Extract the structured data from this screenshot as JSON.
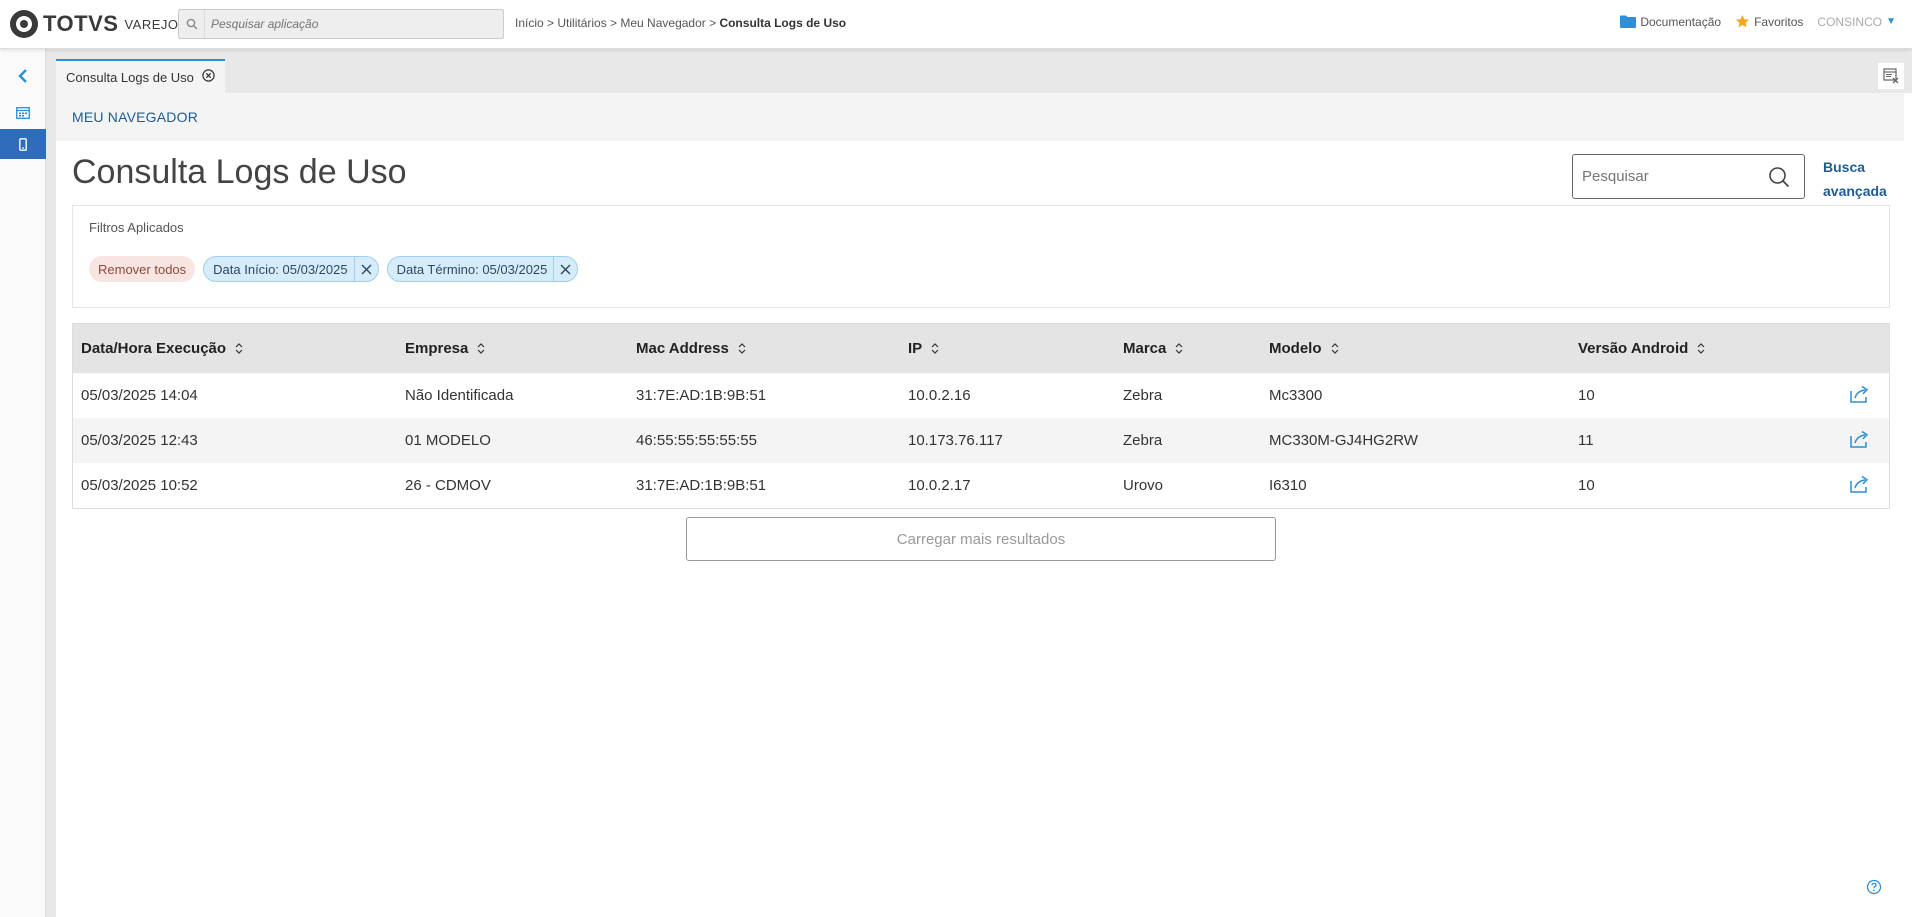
{
  "brand": {
    "name": "TOTVS",
    "sub": "VAREJO"
  },
  "app_search": {
    "placeholder": "Pesquisar aplicação"
  },
  "breadcrumb": {
    "path": "Início > Utilitários > Meu Navegador > ",
    "current": "Consulta Logs de Uso"
  },
  "top_links": {
    "docs": "Documentação",
    "favorites": "Favoritos",
    "user": "CONSINCO"
  },
  "tab": {
    "label": "Consulta Logs de Uso"
  },
  "section": {
    "link": "MEU NAVEGADOR"
  },
  "page": {
    "title": "Consulta Logs de Uso"
  },
  "search": {
    "placeholder": "Pesquisar",
    "advanced_line1": "Busca",
    "advanced_line2": "avançada"
  },
  "filters": {
    "title": "Filtros Aplicados",
    "remove_all": "Remover todos",
    "chips": [
      "Data Início: 05/03/2025",
      "Data Término: 05/03/2025"
    ]
  },
  "table": {
    "columns": [
      "Data/Hora Execução",
      "Empresa",
      "Mac Address",
      "IP",
      "Marca",
      "Modelo",
      "Versão Android"
    ],
    "rows": [
      [
        "05/03/2025 14:04",
        "Não Identificada",
        "31:7E:AD:1B:9B:51",
        "10.0.2.16",
        "Zebra",
        "Mc3300",
        "10"
      ],
      [
        "05/03/2025 12:43",
        "01 MODELO",
        "46:55:55:55:55:55",
        "10.173.76.117",
        "Zebra",
        "MC330M-GJ4HG2RW",
        "11"
      ],
      [
        "05/03/2025 10:52",
        "26 - CDMOV",
        "31:7E:AD:1B:9B:51",
        "10.0.2.17",
        "Urovo",
        "I6310",
        "10"
      ]
    ]
  },
  "load_more": "Carregar mais resultados",
  "colors": {
    "accent": "#2d8fd5",
    "rail_active": "#2f6dba",
    "link": "#1e5c96",
    "star": "#f5a623"
  },
  "icons": [
    "search-icon",
    "folder-icon",
    "star-icon",
    "chevron-left-icon",
    "calendar-icon",
    "mobile-icon",
    "close-circle-icon",
    "clear-screen-icon",
    "close-icon",
    "sort-icon",
    "share-icon",
    "help-icon"
  ]
}
